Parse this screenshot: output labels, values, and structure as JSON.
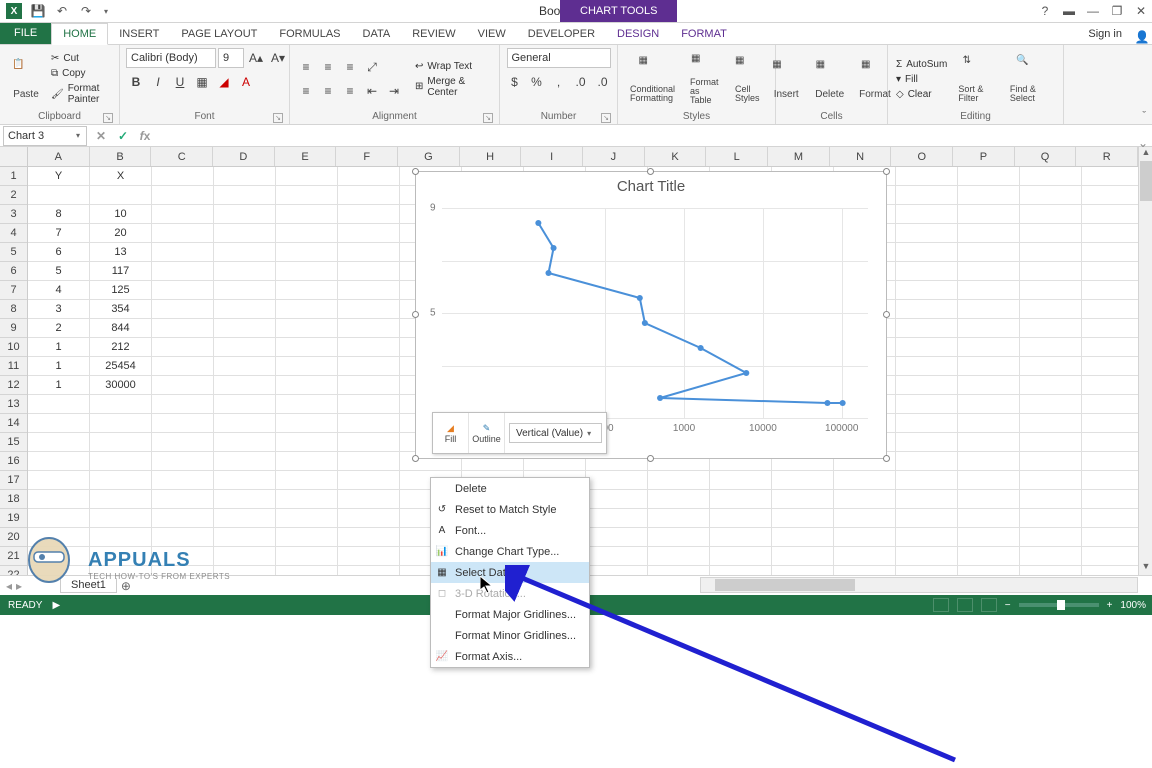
{
  "title": "Book1 - Excel",
  "chart_tools_label": "CHART TOOLS",
  "signin": "Sign in",
  "tabs": {
    "file": "FILE",
    "items": [
      "HOME",
      "INSERT",
      "PAGE LAYOUT",
      "FORMULAS",
      "DATA",
      "REVIEW",
      "VIEW",
      "DEVELOPER"
    ],
    "ctx": [
      "DESIGN",
      "FORMAT"
    ]
  },
  "ribbon": {
    "clipboard": {
      "label": "Clipboard",
      "paste": "Paste",
      "cut": "Cut",
      "copy": "Copy",
      "painter": "Format Painter"
    },
    "font": {
      "label": "Font",
      "name": "Calibri (Body)",
      "size": "9"
    },
    "alignment": {
      "label": "Alignment",
      "wrap": "Wrap Text",
      "merge": "Merge & Center"
    },
    "number": {
      "label": "Number",
      "format": "General"
    },
    "styles": {
      "label": "Styles",
      "cond": "Conditional Formatting",
      "table": "Format as Table",
      "cell": "Cell Styles"
    },
    "cells": {
      "label": "Cells",
      "insert": "Insert",
      "delete": "Delete",
      "format": "Format"
    },
    "editing": {
      "label": "Editing",
      "sum": "AutoSum",
      "fill": "Fill",
      "clear": "Clear",
      "sort": "Sort & Filter",
      "find": "Find & Select"
    }
  },
  "name_box": "Chart 3",
  "columns": [
    "A",
    "B",
    "C",
    "D",
    "E",
    "F",
    "G",
    "H",
    "I",
    "J",
    "K",
    "L",
    "M",
    "N",
    "O",
    "P",
    "Q",
    "R"
  ],
  "rows_visible": 22,
  "sheet": {
    "data": [
      [
        "Y",
        "X"
      ],
      [
        "",
        ""
      ],
      [
        "8",
        "10"
      ],
      [
        "7",
        "20"
      ],
      [
        "6",
        "13"
      ],
      [
        "5",
        "117"
      ],
      [
        "4",
        "125"
      ],
      [
        "3",
        "354"
      ],
      [
        "2",
        "844"
      ],
      [
        "1",
        "212"
      ],
      [
        "1",
        "25454"
      ],
      [
        "1",
        "30000"
      ]
    ]
  },
  "chart": {
    "title": "Chart Title"
  },
  "chart_data": {
    "type": "line",
    "x": [
      10,
      20,
      13,
      117,
      125,
      354,
      844,
      212,
      25454,
      30000
    ],
    "y": [
      8,
      7,
      6,
      5,
      4,
      3,
      2,
      1,
      1,
      1
    ],
    "x_scale": "log",
    "x_ticks": [
      "100",
      "1000",
      "10000",
      "100000"
    ],
    "y_ticks": [
      "9",
      "5"
    ],
    "title": "Chart Title",
    "xlabel": "",
    "ylabel": ""
  },
  "mini_toolbar": {
    "fill": "Fill",
    "outline": "Outline",
    "selector": "Vertical (Value)"
  },
  "context_menu": {
    "delete": "Delete",
    "reset": "Reset to Match Style",
    "font": "Font...",
    "change_type": "Change Chart Type...",
    "select_data": "Select Data...",
    "rotation": "3-D Rotation...",
    "major": "Format Major Gridlines...",
    "minor": "Format Minor Gridlines...",
    "axis": "Format Axis..."
  },
  "sheet_tab": "Sheet1",
  "status": {
    "ready": "READY",
    "zoom": "100%"
  },
  "watermark": {
    "brand": "APPUALS",
    "sub": "TECH HOW-TO'S FROM EXPERTS"
  }
}
